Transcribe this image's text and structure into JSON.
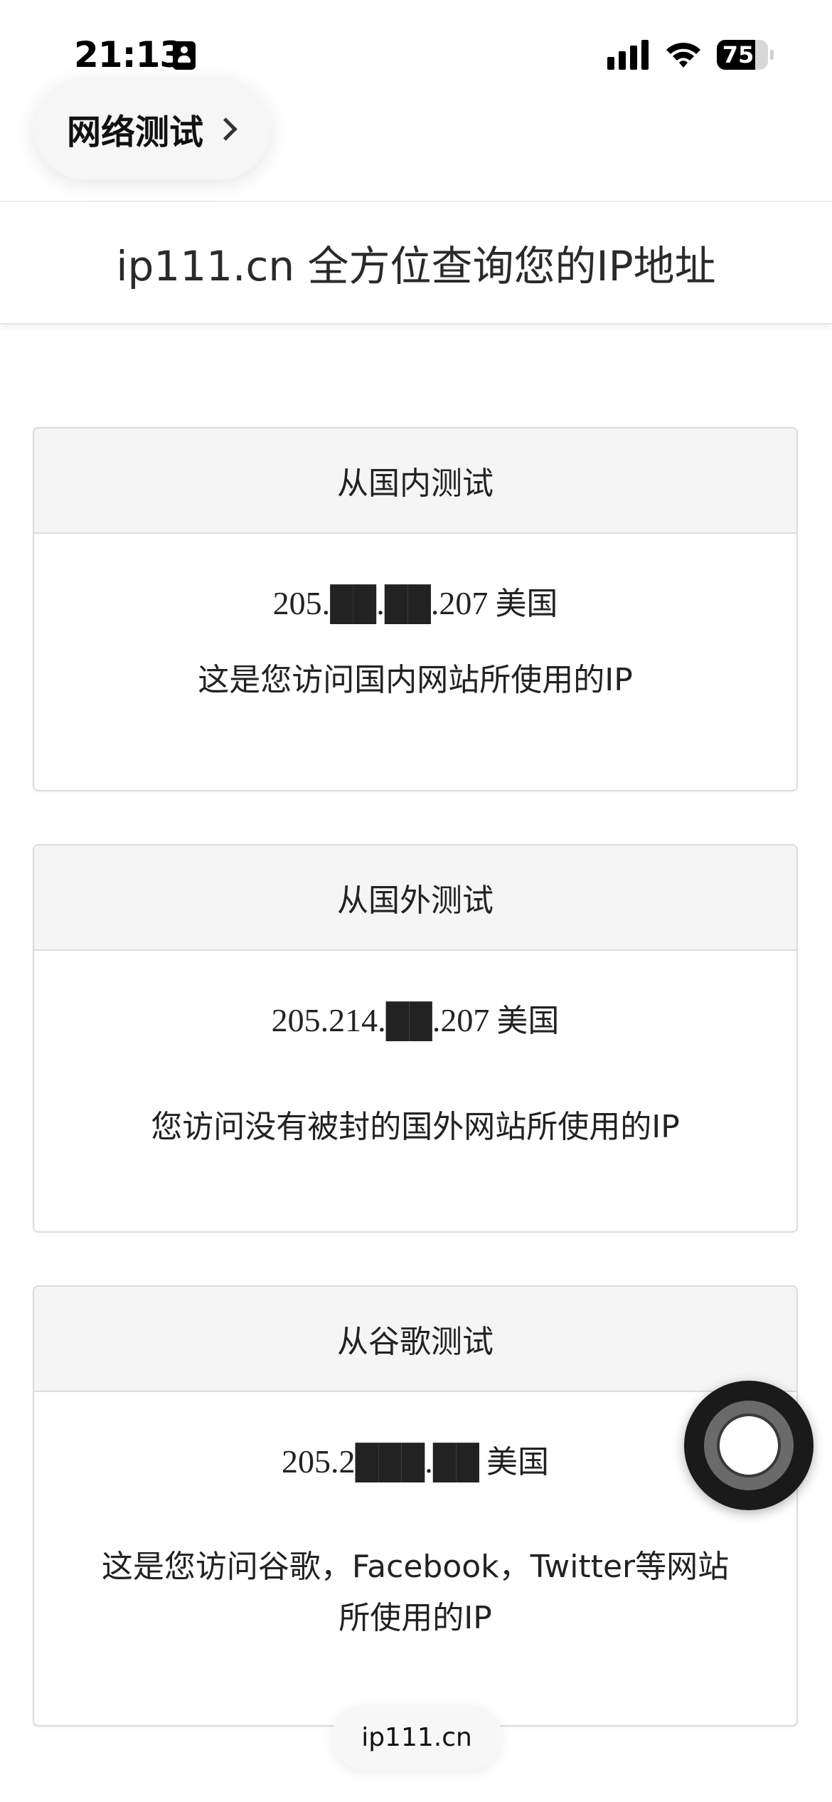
{
  "status_bar": {
    "time": "21:13",
    "battery_level": "75",
    "battery_fraction": 0.75
  },
  "nav": {
    "back_label": "网络测试"
  },
  "header": {
    "title": "ip111.cn 全方位查询您的IP地址"
  },
  "cards": [
    {
      "title": "从国内测试",
      "ip": "205.██.██.207",
      "country": "美国",
      "description": "这是您访问国内网站所使用的IP"
    },
    {
      "title": "从国外测试",
      "ip": "205.214.██.207",
      "country": "美国",
      "description": "您访问没有被封的国外网站所使用的IP"
    },
    {
      "title": "从谷歌测试",
      "ip": "205.2███.██",
      "country": "美国",
      "description_line1": "这是您访问谷歌，Facebook，Twitter等网站",
      "description_line2": "所使用的IP"
    }
  ],
  "footer": {
    "url": "ip111.cn"
  },
  "icons": {
    "id_badge": "person-badge-icon",
    "signal": "cellular-signal-icon",
    "wifi": "wifi-icon",
    "battery": "battery-icon",
    "chevron": "chevron-right-icon",
    "assistive_touch": "assistive-touch-icon"
  }
}
